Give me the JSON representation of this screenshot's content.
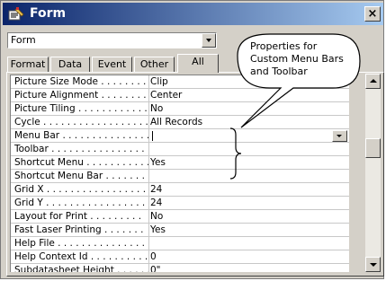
{
  "window": {
    "title": "Form",
    "close_label": "×"
  },
  "selector": {
    "value": "Form"
  },
  "tabs": [
    {
      "label": "Format",
      "active": false
    },
    {
      "label": "Data",
      "active": false
    },
    {
      "label": "Event",
      "active": false
    },
    {
      "label": "Other",
      "active": false
    },
    {
      "label": "All",
      "active": true
    }
  ],
  "properties": [
    {
      "name": "Picture Size Mode . . . . . . . .",
      "value": "Clip"
    },
    {
      "name": "Picture Alignment . . . . . . . .",
      "value": "Center"
    },
    {
      "name": "Picture Tiling . . . . . . . . . . . .",
      "value": "No"
    },
    {
      "name": "Cycle . . . . . . . . . . . . . . . . . . .",
      "value": "All Records"
    },
    {
      "name": "Menu Bar . . . . . . . . . . . . . . .",
      "value": ""
    },
    {
      "name": "Toolbar . . . . . . . . . . . . . . . . .",
      "value": ""
    },
    {
      "name": "Shortcut Menu . . . . . . . . . . .",
      "value": "Yes"
    },
    {
      "name": "Shortcut Menu Bar . . . . . . .",
      "value": ""
    },
    {
      "name": "Grid X . . . . . . . . . . . . . . . . . .",
      "value": "24"
    },
    {
      "name": "Grid Y . . . . . . . . . . . . . . . . . .",
      "value": "24"
    },
    {
      "name": "Layout for Print . . . . . . . . .",
      "value": "No"
    },
    {
      "name": "Fast Laser Printing . . . . . . .",
      "value": "Yes"
    },
    {
      "name": "Help File . . . . . . . . . . . . . . . .",
      "value": ""
    },
    {
      "name": "Help Context Id . . . . . . . . . .",
      "value": "0"
    },
    {
      "name": "Subdatasheet Height . . . . . .",
      "value": "0\""
    }
  ],
  "callout": {
    "text_lines": [
      "Properties for",
      "Custom Menu Bars",
      "and Toolbar"
    ]
  },
  "colors": {
    "titlebar_start": "#0a246a",
    "titlebar_end": "#a6caf0",
    "face": "#d4d0c8"
  }
}
